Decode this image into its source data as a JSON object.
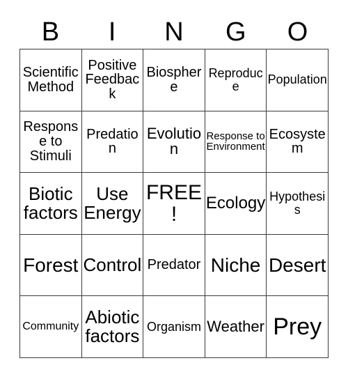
{
  "card": {
    "title": "BINGO",
    "header_letters": [
      "B",
      "I",
      "N",
      "G",
      "O"
    ],
    "free_space_label": "FREE!",
    "colors": {
      "background": "#ffffff",
      "border": "#3a3a3a",
      "text": "#000000"
    },
    "rows": [
      [
        {
          "label": "Scientific Method",
          "size": "fs-m"
        },
        {
          "label": "Positive Feedback",
          "size": "fs-m"
        },
        {
          "label": "Biosphere",
          "size": "fs-m"
        },
        {
          "label": "Reproduce",
          "size": "fs-sm"
        },
        {
          "label": "Population",
          "size": "fs-sm"
        }
      ],
      [
        {
          "label": "Response to Stimuli",
          "size": "fs-m"
        },
        {
          "label": "Predation",
          "size": "fs-m"
        },
        {
          "label": "Evolution",
          "size": "fs-ml"
        },
        {
          "label": "Response to Environment",
          "size": "fs-xs"
        },
        {
          "label": "Ecosystem",
          "size": "fs-m"
        }
      ],
      [
        {
          "label": "Biotic factors",
          "size": "fs-xl"
        },
        {
          "label": "Use Energy",
          "size": "fs-xl"
        },
        {
          "label": "FREE!",
          "size": "fs-3xl"
        },
        {
          "label": "Ecology",
          "size": "fs-l"
        },
        {
          "label": "Hypothesis",
          "size": "fs-sm"
        }
      ],
      [
        {
          "label": "Forest",
          "size": "fs-xxl"
        },
        {
          "label": "Control",
          "size": "fs-xl"
        },
        {
          "label": "Predator",
          "size": "fs-m"
        },
        {
          "label": "Niche",
          "size": "fs-xxl"
        },
        {
          "label": "Desert",
          "size": "fs-xxl"
        }
      ],
      [
        {
          "label": "Community",
          "size": "fs-s"
        },
        {
          "label": "Abiotic factors",
          "size": "fs-xl"
        },
        {
          "label": "Organism",
          "size": "fs-sm"
        },
        {
          "label": "Weather",
          "size": "fs-ml"
        },
        {
          "label": "Prey",
          "size": "fs-4xl"
        }
      ]
    ]
  }
}
